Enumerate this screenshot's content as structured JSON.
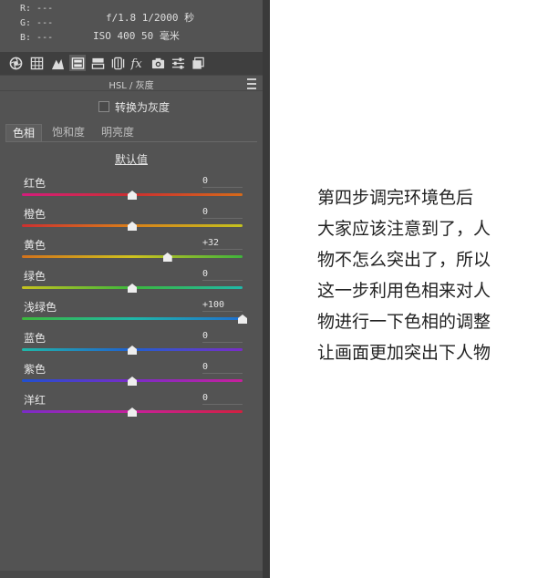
{
  "info": {
    "r_label": "R: ---",
    "g_label": "G: ---",
    "b_label": "B: ---",
    "aperture_shutter": "f/1.8  1/2000 秒",
    "iso_focal": "ISO 400   50 毫米"
  },
  "toolbar": {
    "icons": [
      "aperture-icon",
      "grid-icon",
      "tone-curve-icon",
      "hsl-icon",
      "split-toning-icon",
      "lens-icon",
      "fx-icon",
      "camera-icon",
      "sliders-icon",
      "presets-icon"
    ],
    "active": "hsl-icon"
  },
  "panel": {
    "title": "HSL / 灰度",
    "convert_gray_label": "转换为灰度",
    "tabs": [
      "色相",
      "饱和度",
      "明亮度"
    ],
    "active_tab": "色相",
    "default_link": "默认值"
  },
  "sliders": [
    {
      "label": "红色",
      "value": "0",
      "slider_level": 0.5
    },
    {
      "label": "橙色",
      "value": "0",
      "slider_level": 0.5
    },
    {
      "label": "黄色",
      "value": "+32",
      "slider_level": 0.66
    },
    {
      "label": "绿色",
      "value": "0",
      "slider_level": 0.5
    },
    {
      "label": "浅绿色",
      "value": "+100",
      "slider_level": 1.0
    },
    {
      "label": "蓝色",
      "value": "0",
      "slider_level": 0.5
    },
    {
      "label": "紫色",
      "value": "0",
      "slider_level": 0.5
    },
    {
      "label": "洋红",
      "value": "0",
      "slider_level": 0.5
    }
  ],
  "slider_gradients": [
    "linear-gradient(90deg,#d41d7c,#cc3030 50%,#d66a1a)",
    "linear-gradient(90deg,#cc3030,#d9801a 50%,#c4c21e)",
    "linear-gradient(90deg,#d3721b,#cfc21e 50%,#3fb43c)",
    "linear-gradient(90deg,#c6c21e,#3cb83c 50%,#1fb8a8)",
    "linear-gradient(90deg,#3cb83c,#1fb8a8 50%,#1f6fd0)",
    "linear-gradient(90deg,#1fb8a8,#2060d0 50%,#7a2cc8)",
    "linear-gradient(90deg,#2050d0,#7a2cc8 50%,#c8209c)",
    "linear-gradient(90deg,#7a2cc8,#c8209c 50%,#d22040)"
  ],
  "article": {
    "lines": [
      "第四步调完环境色后",
      "大家应该注意到了，人",
      "物不怎么突出了，所以",
      "这一步利用色相来对人",
      "物进行一下色相的调整",
      "让画面更加突出下人物"
    ]
  }
}
